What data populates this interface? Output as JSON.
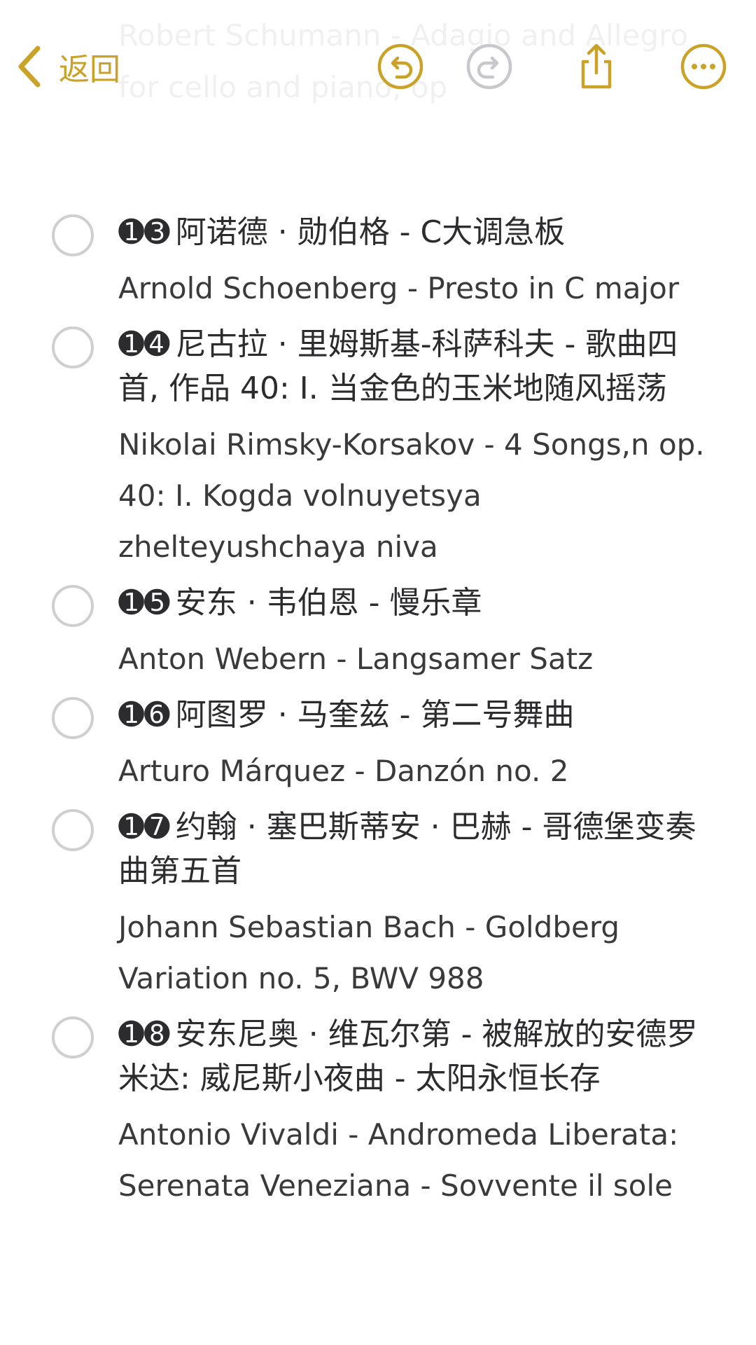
{
  "faded_text": "Robert Schumann - Adagio and Allegro\nfor cello and piano, op",
  "nav": {
    "back_label": "返回",
    "accent_color": "#c9a227",
    "disabled_color": "#c7c7cc",
    "icons": [
      "chevron-left-icon",
      "undo-icon",
      "redo-icon",
      "share-icon",
      "more-icon"
    ]
  },
  "items": [
    {
      "number": "➊➌",
      "chinese": "阿诺德 · 勋伯格 - C大调急板",
      "english": "Arnold Schoenberg - Presto in C major"
    },
    {
      "number": "➊➍",
      "chinese": "尼古拉 · 里姆斯基-科萨科夫 - 歌曲四首, 作品 40: I. 当金色的玉米地随风摇荡",
      "english": "Nikolai Rimsky-Korsakov - 4 Songs,n op. 40: I. Kogda volnuyetsya zhelteyushchaya niva"
    },
    {
      "number": "➊➎",
      "chinese": "安东 · 韦伯恩 - 慢乐章",
      "english": "Anton Webern - Langsamer Satz"
    },
    {
      "number": "➊➏",
      "chinese": "阿图罗 · 马奎兹 - 第二号舞曲",
      "english": "Arturo Márquez - Danzón no. 2"
    },
    {
      "number": "➊➐",
      "chinese": "约翰 · 塞巴斯蒂安 · 巴赫 - 哥德堡变奏曲第五首",
      "english": "Johann Sebastian Bach - Goldberg Variation no. 5, BWV 988"
    },
    {
      "number": "➊➑",
      "chinese": "安东尼奥 · 维瓦尔第 - 被解放的安德罗米达: 威尼斯小夜曲 - 太阳永恒长存",
      "english": "Antonio Vivaldi - Andromeda Liberata: Serenata Veneziana - Sovvente il sole"
    }
  ]
}
